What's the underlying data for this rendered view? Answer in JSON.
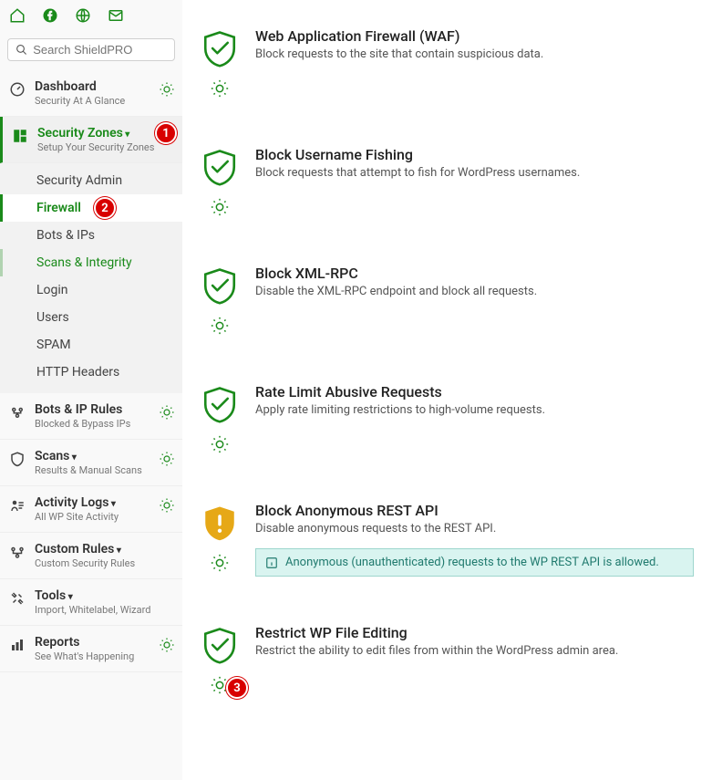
{
  "search": {
    "placeholder": "Search ShieldPRO"
  },
  "nav": {
    "dashboard": {
      "label": "Dashboard",
      "sub": "Security At A Glance"
    },
    "zones": {
      "label": "Security Zones",
      "sub": "Setup Your Security Zones"
    },
    "botsrules": {
      "label": "Bots & IP Rules",
      "sub": "Blocked & Bypass IPs"
    },
    "scans": {
      "label": "Scans",
      "sub": "Results & Manual Scans"
    },
    "activity": {
      "label": "Activity Logs",
      "sub": "All WP Site Activity"
    },
    "custom": {
      "label": "Custom Rules",
      "sub": "Custom Security Rules"
    },
    "tools": {
      "label": "Tools",
      "sub": "Import, Whitelabel, Wizard"
    },
    "reports": {
      "label": "Reports",
      "sub": "See What's Happening"
    }
  },
  "zone_items": {
    "admin": "Security Admin",
    "firewall": "Firewall",
    "botsips": "Bots & IPs",
    "scans": "Scans & Integrity",
    "login": "Login",
    "users": "Users",
    "spam": "SPAM",
    "http": "HTTP Headers"
  },
  "cards": {
    "waf": {
      "title": "Web Application Firewall (WAF)",
      "desc": "Block requests to the site that contain suspicious data."
    },
    "fish": {
      "title": "Block Username Fishing",
      "desc": "Block requests that attempt to fish for WordPress usernames."
    },
    "xml": {
      "title": "Block XML-RPC",
      "desc": "Disable the XML-RPC endpoint and block all requests."
    },
    "rate": {
      "title": "Rate Limit Abusive Requests",
      "desc": "Apply rate limiting restrictions to high-volume requests."
    },
    "rest": {
      "title": "Block Anonymous REST API",
      "desc": "Disable anonymous requests to the REST API.",
      "info": "Anonymous (unauthenticated) requests to the WP REST API is allowed."
    },
    "file": {
      "title": "Restrict WP File Editing",
      "desc": "Restrict the ability to edit files from within the WordPress admin area."
    }
  },
  "badges": {
    "one": "1",
    "two": "2",
    "three": "3"
  }
}
